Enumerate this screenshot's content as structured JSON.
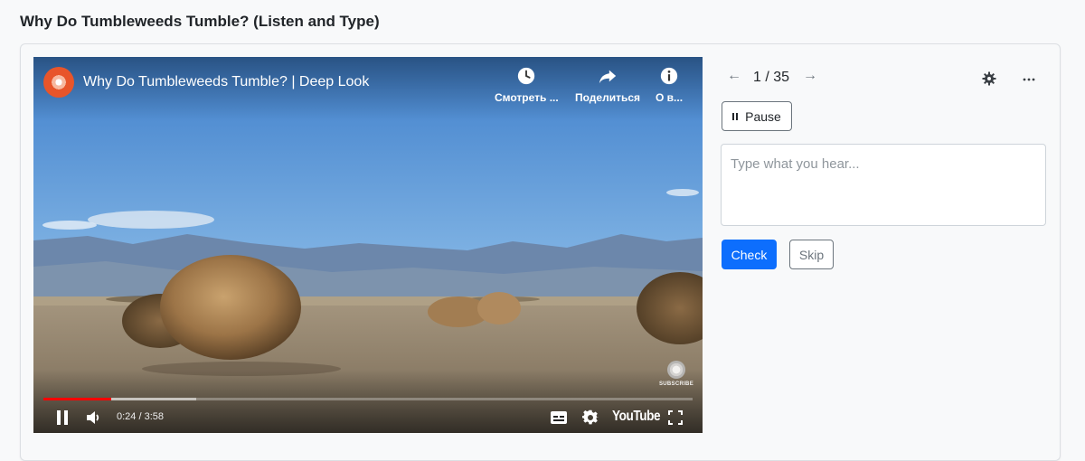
{
  "page": {
    "title": "Why Do Tumbleweeds Tumble? (Listen and Type)"
  },
  "video": {
    "title": "Why Do Tumbleweeds Tumble? | Deep Look",
    "actions": [
      {
        "label": "Смотреть ...",
        "icon": "clock-icon"
      },
      {
        "label": "Поделиться",
        "icon": "share-icon"
      },
      {
        "label": "О в...",
        "icon": "info-icon"
      }
    ],
    "subscribe_label": "SUBSCRIBE",
    "time": "0:24 / 3:58",
    "played_fraction": 0.105,
    "buffered_fraction": 0.236,
    "brand": "YouTube",
    "progress_color": "#ff0000"
  },
  "exercise": {
    "counter": "1 / 35",
    "prev_icon": "arrow-left-icon",
    "next_icon": "arrow-right-icon",
    "pause_label": "Pause",
    "input_placeholder": "Type what you hear...",
    "input_value": "",
    "check_label": "Check",
    "skip_label": "Skip",
    "accent_color": "#0d6efd"
  }
}
